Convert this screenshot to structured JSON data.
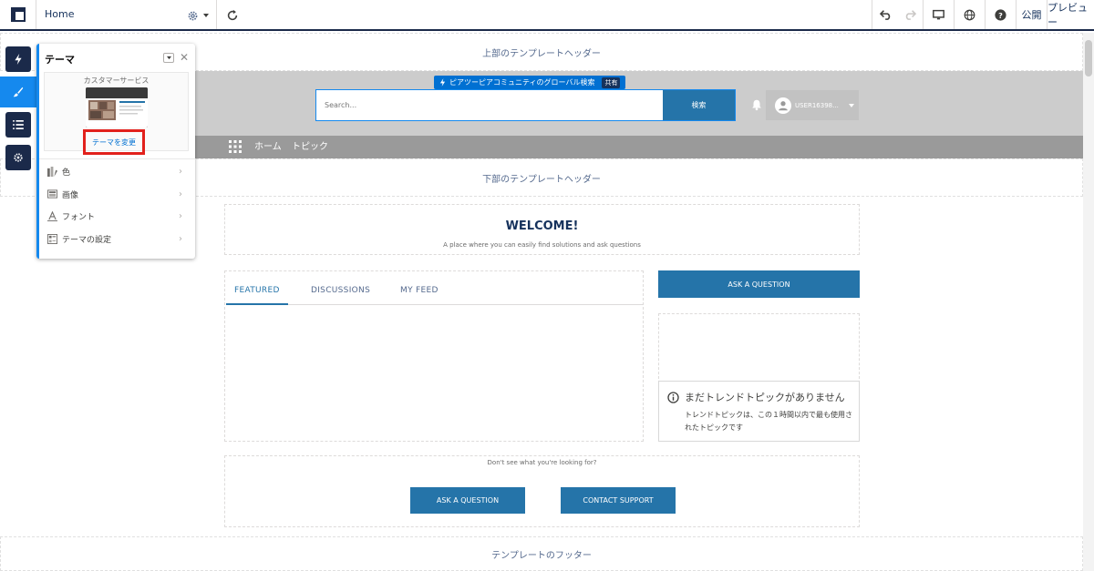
{
  "toolbar": {
    "page_name": "Home",
    "publish_label": "公開",
    "preview_label": "プレビュー"
  },
  "template": {
    "header_top": "上部のテンプレートヘッダー",
    "header_bottom": "下部のテンプレートヘッダー",
    "footer": "テンプレートのフッター"
  },
  "search": {
    "tag_label": "ピアツーピアコミュニティのグローバル検索",
    "shared_badge": "共有",
    "placeholder": "Search...",
    "button_label": "検索"
  },
  "user": {
    "name": "USER16398..."
  },
  "nav": {
    "items": [
      "ホーム",
      "トピック"
    ]
  },
  "welcome": {
    "title": "WELCOME!",
    "subtitle": "A place where you can easily find solutions and ask questions"
  },
  "feed": {
    "tabs": [
      "FEATURED",
      "DISCUSSIONS",
      "MY FEED"
    ],
    "active_tab": "FEATURED"
  },
  "sidebar_right": {
    "ask_label": "ASK A QUESTION",
    "trend_title": "まだトレンドトピックがありません",
    "trend_desc": "トレンドトピックは、この１時間以内で最も使用されたトピックです"
  },
  "support": {
    "question": "Don't see what you're looking for?",
    "ask_label": "ASK A QUESTION",
    "contact_label": "CONTACT SUPPORT"
  },
  "theme_panel": {
    "title": "テーマ",
    "theme_name": "カスタマーサービス",
    "change_label": "テーマを変更",
    "items": [
      {
        "label": "色",
        "icon": "color-palette-icon"
      },
      {
        "label": "画像",
        "icon": "image-icon"
      },
      {
        "label": "フォント",
        "icon": "font-icon"
      },
      {
        "label": "テーマの設定",
        "icon": "settings-layout-icon"
      }
    ]
  },
  "colors": {
    "brand_navy": "#1b2a4a",
    "accent_blue": "#1589ee",
    "button_blue": "#2574a9",
    "highlight_red": "#e2211c"
  }
}
